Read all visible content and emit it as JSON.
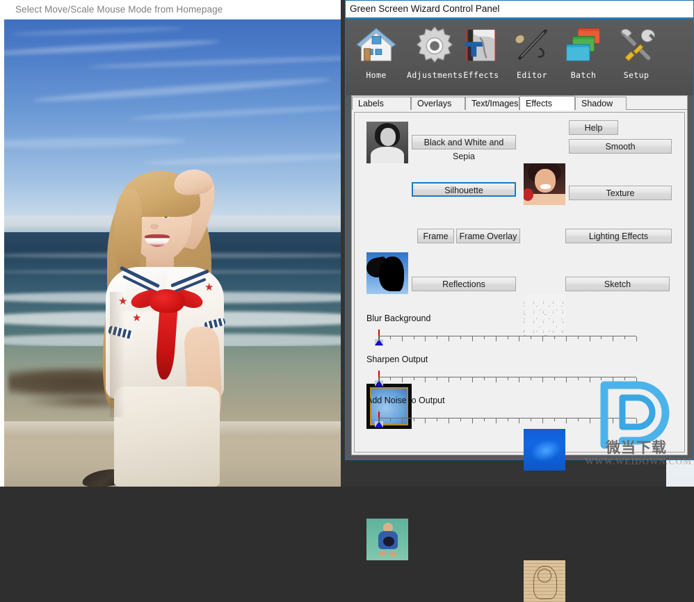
{
  "photo_window": {
    "title": "Select Move/Scale Mouse Mode from Homepage",
    "image_description": "girl-at-beach-photo"
  },
  "behind_window": {
    "minimize_icon": "maximize-icon",
    "chevron_icon": "chevron-down-icon"
  },
  "panel": {
    "title": "Green Screen Wizard Control Panel",
    "toolbar": [
      {
        "label": "Home",
        "icon": "home-icon"
      },
      {
        "label": "Adjustments",
        "icon": "gear-icon"
      },
      {
        "label": "Effects",
        "icon": "book-text-icon"
      },
      {
        "label": "Editor",
        "icon": "pen-icon"
      },
      {
        "label": "Batch",
        "icon": "layers-icon"
      },
      {
        "label": "Setup",
        "icon": "tools-icon"
      }
    ],
    "tabs": [
      {
        "label": "Labels",
        "active": false
      },
      {
        "label": "Overlays",
        "active": false
      },
      {
        "label": "Text/Images",
        "active": false
      },
      {
        "label": "Effects",
        "active": true
      },
      {
        "label": "Shadow",
        "active": false
      }
    ],
    "effects": {
      "help_label": "Help",
      "buttons": {
        "black_and_white": "Black and White and Sepia",
        "smooth": "Smooth",
        "silhouette": "Silhouette",
        "texture": "Texture",
        "frame": "Frame",
        "frame_overlay": "Frame Overlay",
        "lighting_effects": "Lighting Effects",
        "reflections": "Reflections",
        "sketch": "Sketch"
      },
      "thumbnails": {
        "black_and_white": "black-and-white-portrait-thumbnail",
        "smooth": "smooth-portrait-thumbnail",
        "silhouette": "silhouette-thumbnail",
        "texture": "marble-texture-thumbnail",
        "frame": "frame-thumbnail",
        "lighting_effects": "lighting-effects-thumbnail",
        "reflections": "reflections-thumbnail",
        "sketch": "sketch-thumbnail"
      },
      "sliders": [
        {
          "label": "Blur Background",
          "value": 0,
          "min": 0,
          "max": 100,
          "ticks": 23
        },
        {
          "label": "Sharpen Output",
          "value": 0,
          "min": 0,
          "max": 100,
          "ticks": 23
        },
        {
          "label": "Add Noise to Output",
          "value": 0,
          "min": 0,
          "max": 100,
          "ticks": 23
        }
      ]
    },
    "focused_button": "Silhouette"
  },
  "watermark": {
    "logo": "d-logo-icon",
    "text": "微当下载",
    "url": "WWW.WEIDOWN.COM"
  },
  "colors": {
    "accent_blue": "#2484c6",
    "focus_blue": "#1a7ac4",
    "panel_chrome": "#565656",
    "panel_face": "#f0f0f0",
    "slider_thumb": "#1010c8",
    "slider_marker": "#e00000"
  }
}
